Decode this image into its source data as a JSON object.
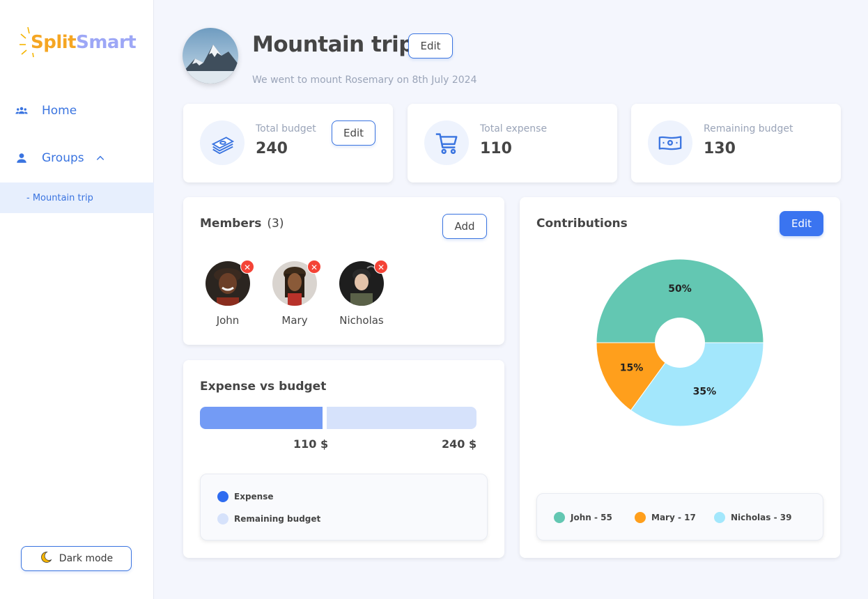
{
  "app": {
    "logo_part1": "Split",
    "logo_part2": "Smart"
  },
  "sidebar": {
    "items": [
      {
        "label": "Home",
        "icon": "group-icon"
      },
      {
        "label": "Groups",
        "icon": "person-icon",
        "expanded": true
      }
    ],
    "sub_items": [
      {
        "label": "- Mountain trip",
        "active": true
      }
    ],
    "dark_mode_label": "Dark mode"
  },
  "header": {
    "title": "Mountain trip",
    "edit_label": "Edit",
    "description": "We went to mount Rosemary on 8th July 2024"
  },
  "stats": [
    {
      "label": "Total budget",
      "value": "240",
      "icon": "money-stack-icon",
      "edit_label": "Edit"
    },
    {
      "label": "Total expense",
      "value": "110",
      "icon": "cart-icon"
    },
    {
      "label": "Remaining budget",
      "value": "130",
      "icon": "banknote-icon"
    }
  ],
  "members": {
    "title": "Members",
    "count": "(3)",
    "add_label": "Add",
    "list": [
      {
        "name": "John"
      },
      {
        "name": "Mary"
      },
      {
        "name": "Nicholas"
      }
    ]
  },
  "expense_vs_budget": {
    "title": "Expense vs budget",
    "expense_label": "110 $",
    "budget_label": "240 $",
    "expense_fraction": 0.458,
    "legend": [
      {
        "label": "Expense",
        "color": "#2f6cf0"
      },
      {
        "label": "Remaining budget",
        "color": "#d6e2fb"
      }
    ]
  },
  "contributions": {
    "title": "Contributions",
    "edit_label": "Edit",
    "legend": [
      {
        "label": "John - 55",
        "color": "#63c7b2"
      },
      {
        "label": "Mary - 17",
        "color": "#ff9f1c"
      },
      {
        "label": "Nicholas - 39",
        "color": "#a3e7fc"
      }
    ]
  },
  "chart_data": {
    "type": "pie",
    "categories": [
      "John",
      "Mary",
      "Nicholas"
    ],
    "values": [
      50,
      15,
      35
    ],
    "labels": [
      "50%",
      "15%",
      "35%"
    ],
    "colors": [
      "#63c7b2",
      "#ff9f1c",
      "#a3e7fc"
    ],
    "title": "Contributions"
  }
}
